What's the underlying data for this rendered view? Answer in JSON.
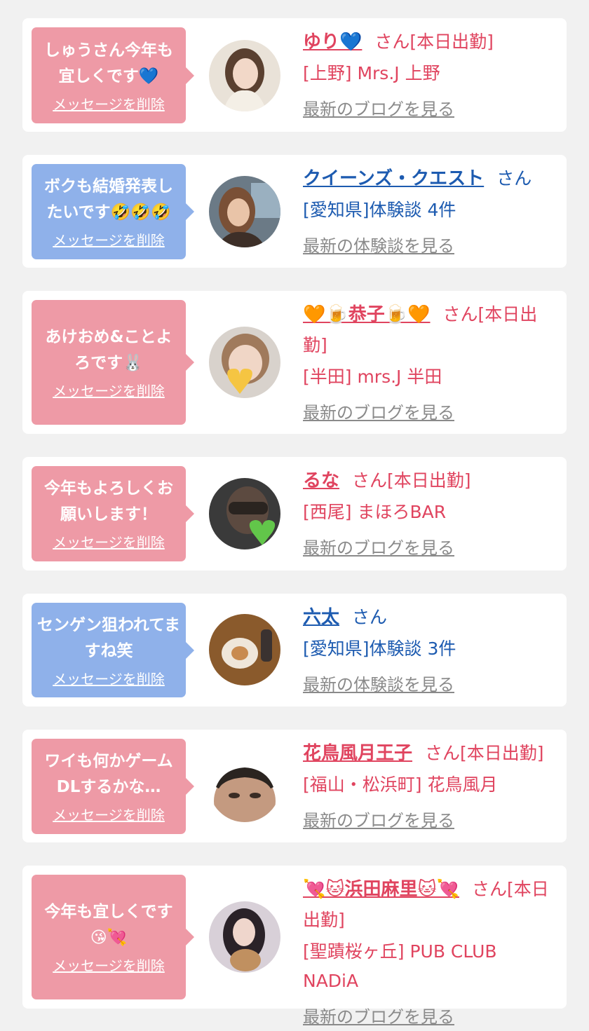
{
  "cards": [
    {
      "message": "しゅうさん今年も宜しくです💙",
      "delete_label": "メッセージを削除",
      "name": "ゆり💙",
      "suffix": "さん[本日出勤]",
      "location": "[上野] Mrs.J 上野",
      "link": "最新のブログを見る",
      "bubble_color": "#ee9aa6",
      "text_color": "#e0445f"
    },
    {
      "message": "ボクも結婚発表したいです🤣🤣🤣",
      "delete_label": "メッセージを削除",
      "name": "クイーンズ・クエスト",
      "suffix": "さん",
      "location": "[愛知県]体験談 4件",
      "link": "最新の体験談を見る",
      "bubble_color": "#8fb1ea",
      "text_color": "#1d5bb0"
    },
    {
      "message": "あけおめ&ことよろです🐰",
      "delete_label": "メッセージを削除",
      "name": "🧡🍺恭子🍺🧡",
      "suffix": "さん[本日出勤]",
      "location": "[半田] mrs.J 半田",
      "link": "最新のブログを見る",
      "bubble_color": "#ee9aa6",
      "text_color": "#e0445f"
    },
    {
      "message": "今年もよろしくお願いします！",
      "delete_label": "メッセージを削除",
      "name": "るな",
      "suffix": "さん[本日出勤]",
      "location": "[西尾] まほろBAR",
      "link": "最新のブログを見る",
      "bubble_color": "#ee9aa6",
      "text_color": "#e0445f"
    },
    {
      "message": "センゲン狙われてますね笑",
      "delete_label": "メッセージを削除",
      "name": "六太",
      "suffix": "さん",
      "location": "[愛知県]体験談 3件",
      "link": "最新の体験談を見る",
      "bubble_color": "#8fb1ea",
      "text_color": "#1d5bb0"
    },
    {
      "message": "ワイも何かゲームDLするかな…",
      "delete_label": "メッセージを削除",
      "name": "花鳥風月王子",
      "suffix": "さん[本日出勤]",
      "location": "[福山・松浜町] 花鳥風月",
      "link": "最新のブログを見る",
      "bubble_color": "#ee9aa6",
      "text_color": "#e0445f"
    },
    {
      "message": "今年も宜しくです😘💘",
      "delete_label": "メッセージを削除",
      "name": "💘🐱浜田麻里🐱💘",
      "suffix": "さん[本日出勤]",
      "location": "[聖蹟桜ヶ丘] PUB CLUB NADiA",
      "link": "最新のブログを見る",
      "bubble_color": "#ee9aa6",
      "text_color": "#e0445f"
    }
  ]
}
